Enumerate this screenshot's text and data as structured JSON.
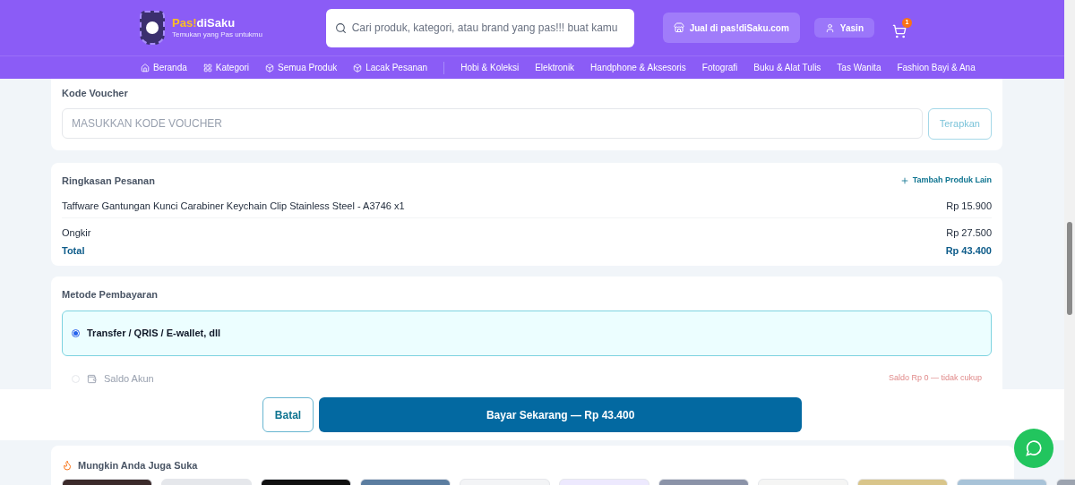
{
  "header": {
    "logo_name_part1": "Pas!",
    "logo_name_part2": "diSaku",
    "tagline": "Temukan yang Pas untukmu",
    "search": {
      "placeholder": "Cari produk, kategori, atau brand yang pas!!! buat kamu"
    },
    "sell_button": "Jual di pas!diSaku.com",
    "user": "Yasin",
    "cart_count": "1"
  },
  "nav": {
    "main": [
      {
        "label": "Beranda",
        "kind": "home"
      },
      {
        "label": "Kategori",
        "kind": "grid"
      },
      {
        "label": "Semua Produk",
        "kind": "box"
      },
      {
        "label": "Lacak Pesanan",
        "kind": "box"
      }
    ],
    "categories": [
      "Hobi & Koleksi",
      "Elektronik",
      "Handphone & Aksesoris",
      "Fotografi",
      "Buku & Alat Tulis",
      "Tas Wanita",
      "Fashion Bayi & Ana"
    ]
  },
  "voucher": {
    "title": "Kode Voucher",
    "placeholder": "MASUKKAN KODE VOUCHER",
    "apply": "Terapkan"
  },
  "summary": {
    "title": "Ringkasan Pesanan",
    "add": "Tambah Produk Lain",
    "items": [
      {
        "name": "Taffware Gantungan Kunci Carabiner Keychain Clip Stainless Steel - A3746 x1",
        "price": "Rp 15.900"
      }
    ],
    "shipping_label": "Ongkir",
    "shipping": "Rp 27.500",
    "total_label": "Total",
    "total": "Rp 43.400"
  },
  "payment": {
    "title": "Metode Pembayaran",
    "options": [
      {
        "label": "Transfer / QRIS / E-wallet, dll",
        "selected": true,
        "disabled": false
      },
      {
        "label": "Saldo Akun",
        "selected": false,
        "disabled": true,
        "note": "Saldo Rp 0 — tidak cukup"
      }
    ]
  },
  "actions": {
    "cancel": "Batal",
    "pay": "Bayar Sekarang — Rp 43.400"
  },
  "recommend": {
    "title": "Mungkin Anda Juga Suka"
  }
}
